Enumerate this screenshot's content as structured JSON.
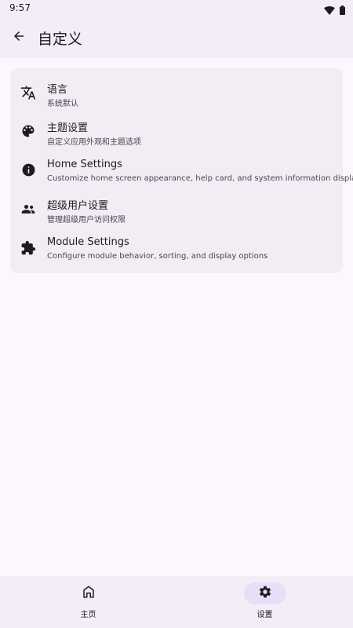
{
  "status_bar": {
    "time": "9:57",
    "icons": [
      "wifi-icon",
      "battery-icon"
    ]
  },
  "app_bar": {
    "title": "自定义",
    "back_icon": "arrow-back-icon"
  },
  "settings": {
    "items": [
      {
        "icon": "translate-icon",
        "title": "语言",
        "subtitle": "系统默认"
      },
      {
        "icon": "palette-icon",
        "title": "主题设置",
        "subtitle": "自定义应用外观和主题选项"
      },
      {
        "icon": "info-icon",
        "title": "Home Settings",
        "subtitle": "Customize home screen appearance, help card, and system information display"
      },
      {
        "icon": "superuser-icon",
        "title": "超级用户设置",
        "subtitle": "管理超级用户访问权限"
      },
      {
        "icon": "puzzle-icon",
        "title": "Module Settings",
        "subtitle": "Configure module behavior, sorting, and display options"
      }
    ]
  },
  "bottom_nav": {
    "items": [
      {
        "icon": "home-icon",
        "label": "主页",
        "active": false
      },
      {
        "icon": "gear-icon",
        "label": "设置",
        "active": true
      }
    ]
  },
  "colors": {
    "background": "#fdf7fd",
    "surface_container": "#f3edf7",
    "card": "#f2ecf5",
    "active_indicator": "#e8def8",
    "on_surface": "#1d1b20",
    "on_surface_variant": "#49454f"
  }
}
